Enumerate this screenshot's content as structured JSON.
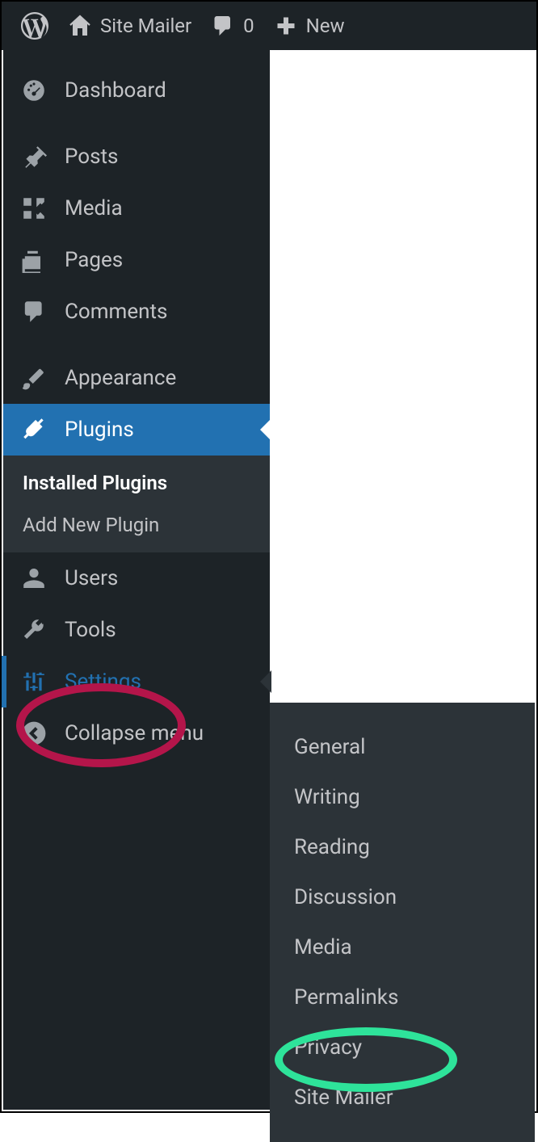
{
  "topbar": {
    "site_title": "Site Mailer",
    "comments_count": "0",
    "new_label": "New"
  },
  "sidebar": {
    "dashboard": "Dashboard",
    "posts": "Posts",
    "media": "Media",
    "pages": "Pages",
    "comments": "Comments",
    "appearance": "Appearance",
    "plugins": "Plugins",
    "plugins_sub": {
      "installed": "Installed Plugins",
      "add_new": "Add New Plugin"
    },
    "users": "Users",
    "tools": "Tools",
    "settings": "Settings",
    "collapse": "Collapse menu"
  },
  "flyout": {
    "general": "General",
    "writing": "Writing",
    "reading": "Reading",
    "discussion": "Discussion",
    "media": "Media",
    "permalinks": "Permalinks",
    "privacy": "Privacy",
    "site_mailer": "Site Mailer"
  }
}
